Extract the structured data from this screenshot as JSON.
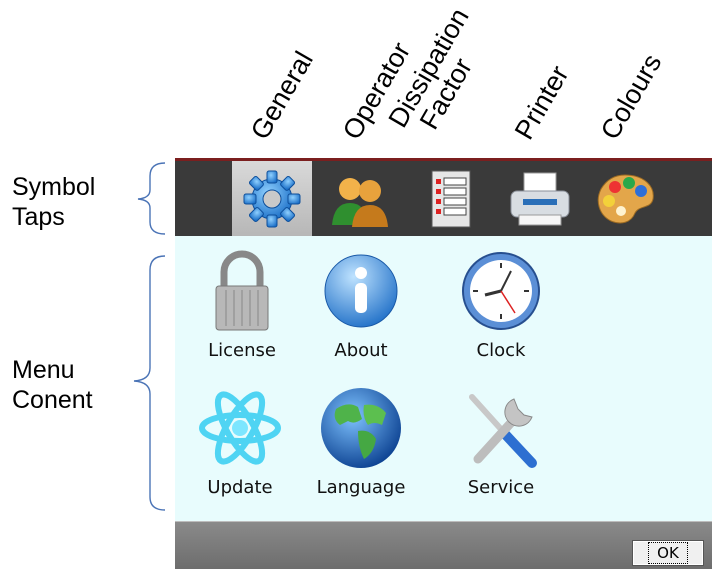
{
  "tab_labels": {
    "general": "General",
    "operator": "Operator",
    "dissipation_line1": "Dissipation",
    "dissipation_line2": "Factor",
    "printer": "Printer",
    "colours": "Colours"
  },
  "annotations": {
    "symbol_taps_line1": "Symbol",
    "symbol_taps_line2": "Taps",
    "menu_content_line1": "Menu",
    "menu_content_line2": "Conent"
  },
  "tabs": [
    {
      "id": "general",
      "icon": "gear-icon",
      "active": true
    },
    {
      "id": "operator",
      "icon": "users-icon",
      "active": false
    },
    {
      "id": "dissipation",
      "icon": "list-document-icon",
      "active": false
    },
    {
      "id": "printer",
      "icon": "printer-icon",
      "active": false
    },
    {
      "id": "colours",
      "icon": "palette-icon",
      "active": false
    }
  ],
  "menu": {
    "license": "License",
    "about": "About",
    "clock": "Clock",
    "update": "Update",
    "language": "Language",
    "service": "Service"
  },
  "footer": {
    "ok_label": "OK"
  },
  "colors": {
    "tab_bar": "#3a3a3a",
    "tab_bar_border": "#7b1f1f",
    "content_bg": "#e8fcfd",
    "footer": "#777777"
  }
}
